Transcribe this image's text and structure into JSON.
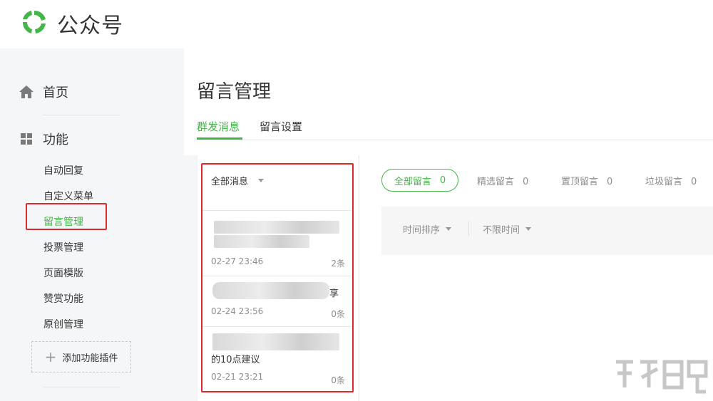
{
  "brand": {
    "name": "公众号",
    "accent": "#44b549"
  },
  "sidebar": {
    "home": {
      "label": "首页",
      "icon": "home-icon"
    },
    "functions": {
      "label": "功能",
      "icon": "grid-icon"
    },
    "items": [
      {
        "label": "自动回复",
        "active": false
      },
      {
        "label": "自定义菜单",
        "active": false
      },
      {
        "label": "留言管理",
        "active": true
      },
      {
        "label": "投票管理",
        "active": false
      },
      {
        "label": "页面模版",
        "active": false
      },
      {
        "label": "赞赏功能",
        "active": false
      },
      {
        "label": "原创管理",
        "active": false
      }
    ],
    "add_plugin": "添加功能插件"
  },
  "main": {
    "title": "留言管理",
    "tabs": [
      {
        "label": "群发消息",
        "active": true
      },
      {
        "label": "留言设置",
        "active": false
      }
    ]
  },
  "messages": {
    "filter_label": "全部消息",
    "items": [
      {
        "date": "02-27 23:46",
        "count": "2条",
        "text": ""
      },
      {
        "date": "02-24 23:56",
        "count": "0条",
        "text": "享"
      },
      {
        "date": "02-21 23:21",
        "count": "0条",
        "text": "的10点建议"
      }
    ]
  },
  "comment_filters": {
    "all": {
      "label": "全部留言",
      "count": "0"
    },
    "featured": {
      "label": "精选留言",
      "count": "0"
    },
    "pinned": {
      "label": "置顶留言",
      "count": "0"
    },
    "spam": {
      "label": "垃圾留言",
      "count": "0"
    }
  },
  "sort": {
    "order": "时间排序",
    "time": "不限时间"
  },
  "highlight_color": "#e0282d"
}
